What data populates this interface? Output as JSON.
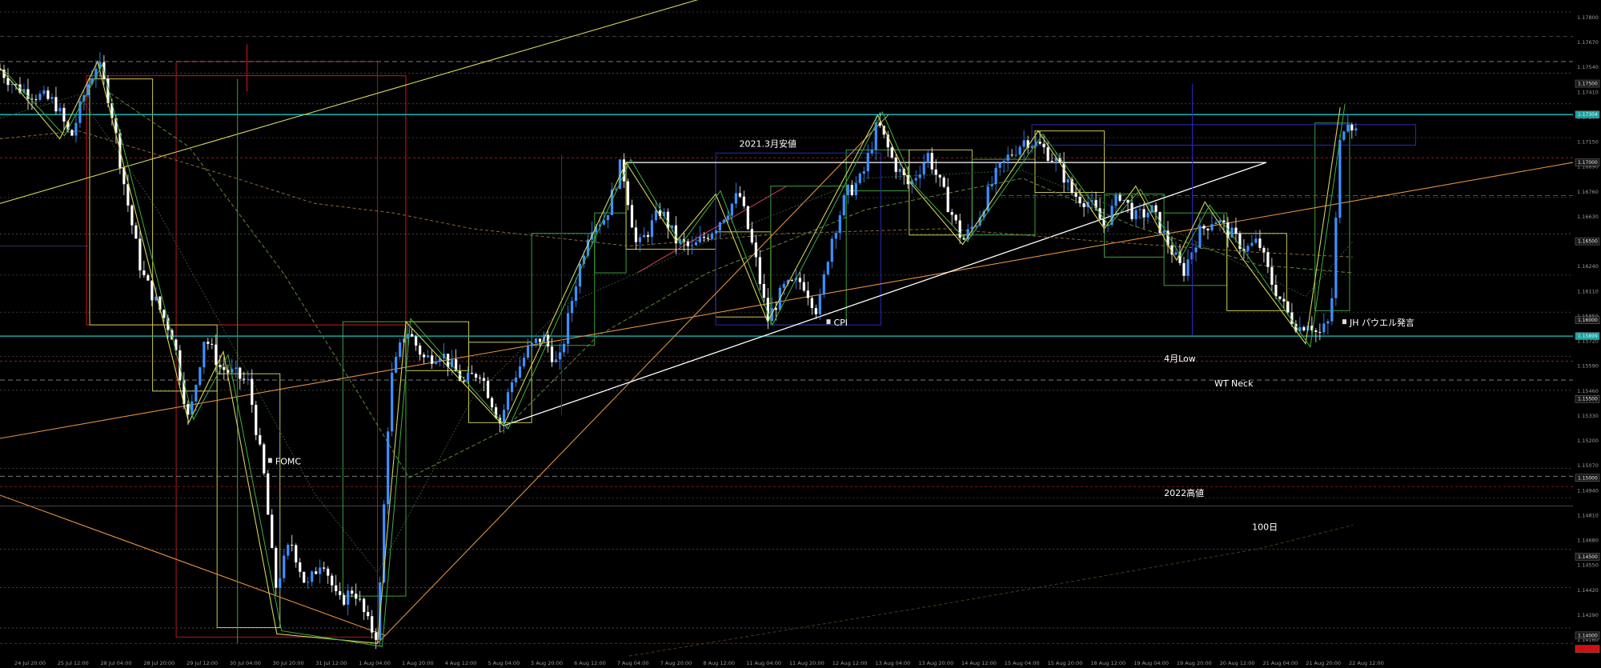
{
  "chart_data": {
    "type": "candlestick",
    "symbol_hint": "",
    "ylim": [
      1.1387,
      1.18
    ],
    "y_ticks": [
      "1.17800",
      "1.17670",
      "1.17540",
      "1.17410",
      "1.17280",
      "1.17150",
      "1.16890",
      "1.16760",
      "1.16630",
      "1.16370",
      "1.16240",
      "1.16110",
      "1.15850",
      "1.15720",
      "1.15590",
      "1.15460",
      "1.15330",
      "1.15200",
      "1.15070",
      "1.14940",
      "1.14810",
      "1.14680",
      "1.14550",
      "1.14420",
      "1.14290",
      "1.14160"
    ],
    "x_ticks": [
      "24 Jul 20:00",
      "25 Jul 12:00",
      "28 Jul 04:00",
      "28 Jul 20:00",
      "29 Jul 12:00",
      "30 Jul 04:00",
      "30 Jul 20:00",
      "31 Jul 12:00",
      "1 Aug 04:00",
      "1 Aug 20:00",
      "4 Aug 12:00",
      "5 Aug 04:00",
      "5 Aug 20:00",
      "6 Aug 12:00",
      "7 Aug 04:00",
      "7 Aug 20:00",
      "8 Aug 12:00",
      "11 Aug 04:00",
      "11 Aug 20:00",
      "12 Aug 12:00",
      "13 Aug 04:00",
      "13 Aug 20:00",
      "14 Aug 12:00",
      "15 Aug 04:00",
      "15 Aug 20:00",
      "18 Aug 12:00",
      "19 Aug 04:00",
      "19 Aug 20:00",
      "20 Aug 12:00",
      "21 Aug 04:00",
      "21 Aug 20:00",
      "22 Aug 12:00"
    ],
    "price_labels": [
      {
        "value": 1.175,
        "text": "1.17500",
        "bg": "#1a1a1a"
      },
      {
        "value": 1.17304,
        "text": "1.17304",
        "bg": "#1aa3a3"
      },
      {
        "value": 1.17,
        "text": "1.17000",
        "bg": "#1a1a1a"
      },
      {
        "value": 1.165,
        "text": "1.16500",
        "bg": "#1a1a1a"
      },
      {
        "value": 1.16,
        "text": "1.16000",
        "bg": "#1a1a1a"
      },
      {
        "value": 1.15899,
        "text": "1.15899",
        "bg": "#1aa3a3"
      },
      {
        "value": 1.155,
        "text": "1.15500",
        "bg": "#1a1a1a"
      },
      {
        "value": 1.15,
        "text": "1.15000",
        "bg": "#1a1a1a"
      },
      {
        "value": 1.145,
        "text": "1.14500",
        "bg": "#1a1a1a"
      },
      {
        "value": 1.14,
        "text": "1.14000",
        "bg": "#1a1a1a"
      },
      {
        "value": 1.13915,
        "text": "",
        "bg": "#d01010"
      }
    ],
    "annotations": [
      {
        "text": "2021.3月安値",
        "t": 0.47,
        "value": 1.1712
      },
      {
        "text": "CPI",
        "t": 0.53,
        "value": 1.15985,
        "icon": true
      },
      {
        "text": "FOMC",
        "t": 0.175,
        "value": 1.15105,
        "icon": true
      },
      {
        "text": "JH パウエル発言",
        "t": 0.858,
        "value": 1.15985,
        "icon": true
      },
      {
        "text": "4月Low",
        "t": 0.74,
        "value": 1.15758
      },
      {
        "text": "WT Neck",
        "t": 0.772,
        "value": 1.156
      },
      {
        "text": "2022高値",
        "t": 0.74,
        "value": 1.14905
      },
      {
        "text": "100日",
        "t": 0.796,
        "value": 1.1469
      }
    ],
    "close_path": [
      [
        0.0,
        1.1759
      ],
      [
        0.01,
        1.1748
      ],
      [
        0.025,
        1.1742
      ],
      [
        0.035,
        1.1738
      ],
      [
        0.045,
        1.1715
      ],
      [
        0.055,
        1.1748
      ],
      [
        0.062,
        1.1764
      ],
      [
        0.07,
        1.1738
      ],
      [
        0.08,
        1.168
      ],
      [
        0.09,
        1.163
      ],
      [
        0.1,
        1.161
      ],
      [
        0.11,
        1.159
      ],
      [
        0.12,
        1.1535
      ],
      [
        0.13,
        1.159
      ],
      [
        0.14,
        1.157
      ],
      [
        0.15,
        1.1565
      ],
      [
        0.158,
        1.156
      ],
      [
        0.168,
        1.15
      ],
      [
        0.175,
        1.143
      ],
      [
        0.185,
        1.146
      ],
      [
        0.195,
        1.143
      ],
      [
        0.205,
        1.145
      ],
      [
        0.215,
        1.142
      ],
      [
        0.225,
        1.143
      ],
      [
        0.235,
        1.1405
      ],
      [
        0.24,
        1.14
      ],
      [
        0.248,
        1.156
      ],
      [
        0.258,
        1.1595
      ],
      [
        0.27,
        1.1575
      ],
      [
        0.28,
        1.158
      ],
      [
        0.295,
        1.156
      ],
      [
        0.305,
        1.1568
      ],
      [
        0.318,
        1.1535
      ],
      [
        0.325,
        1.156
      ],
      [
        0.335,
        1.158
      ],
      [
        0.345,
        1.159
      ],
      [
        0.355,
        1.157
      ],
      [
        0.365,
        1.162
      ],
      [
        0.375,
        1.166
      ],
      [
        0.385,
        1.1665
      ],
      [
        0.395,
        1.17
      ],
      [
        0.405,
        1.1645
      ],
      [
        0.42,
        1.167
      ],
      [
        0.43,
        1.165
      ],
      [
        0.44,
        1.1645
      ],
      [
        0.455,
        1.166
      ],
      [
        0.47,
        1.168
      ],
      [
        0.48,
        1.164
      ],
      [
        0.488,
        1.16
      ],
      [
        0.498,
        1.162
      ],
      [
        0.51,
        1.1625
      ],
      [
        0.52,
        1.1605
      ],
      [
        0.528,
        1.165
      ],
      [
        0.538,
        1.168
      ],
      [
        0.548,
        1.169
      ],
      [
        0.558,
        1.1725
      ],
      [
        0.568,
        1.17
      ],
      [
        0.578,
        1.1685
      ],
      [
        0.59,
        1.1705
      ],
      [
        0.6,
        1.168
      ],
      [
        0.612,
        1.165
      ],
      [
        0.622,
        1.1665
      ],
      [
        0.632,
        1.169
      ],
      [
        0.642,
        1.1705
      ],
      [
        0.652,
        1.1715
      ],
      [
        0.662,
        1.171
      ],
      [
        0.672,
        1.17
      ],
      [
        0.682,
        1.168
      ],
      [
        0.692,
        1.1675
      ],
      [
        0.702,
        1.166
      ],
      [
        0.712,
        1.168
      ],
      [
        0.722,
        1.1665
      ],
      [
        0.732,
        1.167
      ],
      [
        0.742,
        1.165
      ],
      [
        0.752,
        1.163
      ],
      [
        0.762,
        1.1655
      ],
      [
        0.772,
        1.1665
      ],
      [
        0.782,
        1.1655
      ],
      [
        0.792,
        1.1645
      ],
      [
        0.8,
        1.165
      ],
      [
        0.808,
        1.1625
      ],
      [
        0.818,
        1.1605
      ],
      [
        0.826,
        1.1595
      ],
      [
        0.832,
        1.16
      ],
      [
        0.838,
        1.159
      ],
      [
        0.846,
        1.16
      ],
      [
        0.852,
        1.1715
      ],
      [
        0.856,
        1.173
      ],
      [
        0.862,
        1.172
      ]
    ]
  }
}
